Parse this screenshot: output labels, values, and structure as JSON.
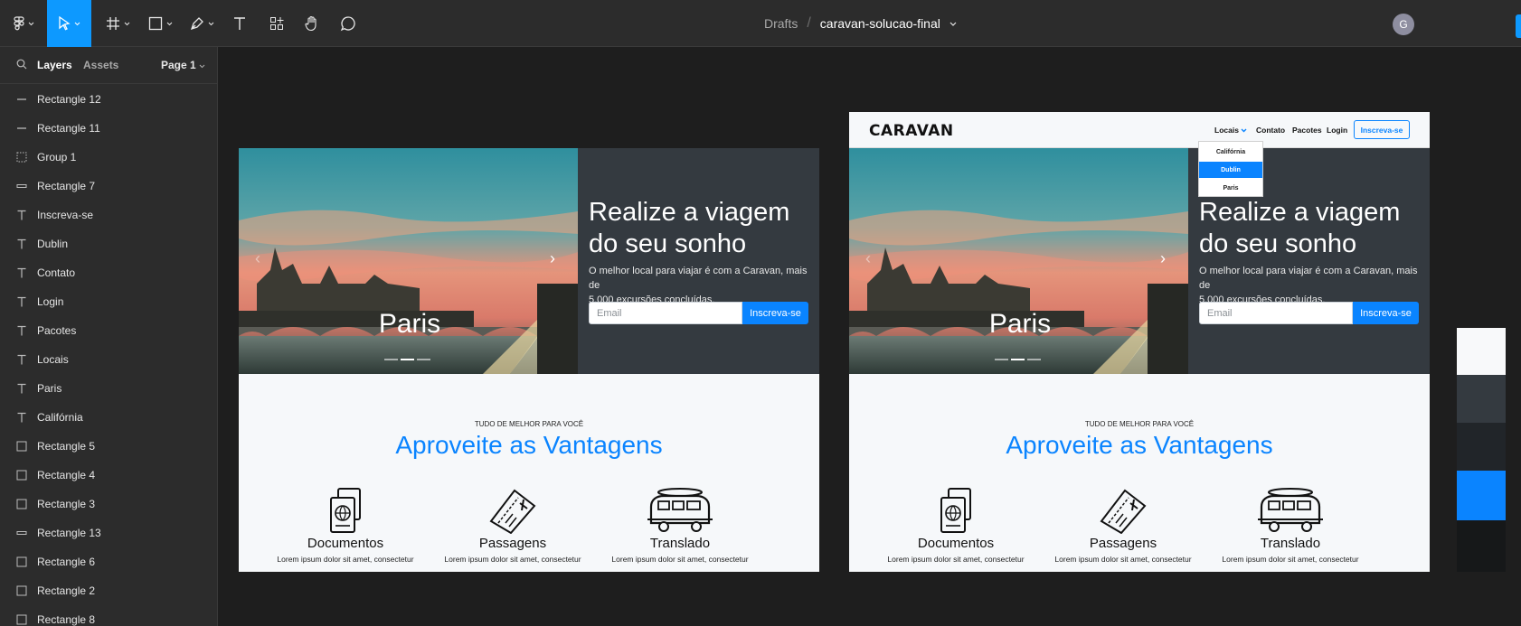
{
  "toolbar": {
    "breadcrumb_root": "Drafts",
    "breadcrumb_sep": "/",
    "file_name": "caravan-solucao-final",
    "avatar_initial": "G",
    "accent": "#0d99ff"
  },
  "sidebar": {
    "tabs": [
      "Layers",
      "Assets"
    ],
    "page_label": "Page 1",
    "layers": [
      {
        "name": "Rectangle 12",
        "icon": "line-icon"
      },
      {
        "name": "Rectangle 11",
        "icon": "line-icon"
      },
      {
        "name": "Group 1",
        "icon": "group-icon"
      },
      {
        "name": "Rectangle 7",
        "icon": "thin-rect-icon"
      },
      {
        "name": "Inscreva-se",
        "icon": "text-icon"
      },
      {
        "name": "Dublin",
        "icon": "text-icon"
      },
      {
        "name": "Contato",
        "icon": "text-icon"
      },
      {
        "name": "Login",
        "icon": "text-icon"
      },
      {
        "name": "Pacotes",
        "icon": "text-icon"
      },
      {
        "name": "Locais",
        "icon": "text-icon"
      },
      {
        "name": "Paris",
        "icon": "text-icon"
      },
      {
        "name": "Califórnia",
        "icon": "text-icon"
      },
      {
        "name": "Rectangle 5",
        "icon": "rect-icon"
      },
      {
        "name": "Rectangle 4",
        "icon": "rect-icon"
      },
      {
        "name": "Rectangle 3",
        "icon": "rect-icon"
      },
      {
        "name": "Rectangle 13",
        "icon": "thin-rect-icon"
      },
      {
        "name": "Rectangle 6",
        "icon": "rect-icon"
      },
      {
        "name": "Rectangle 2",
        "icon": "rect-icon"
      },
      {
        "name": "Rectangle 8",
        "icon": "rect-icon"
      }
    ]
  },
  "design": {
    "hero_title_line1": "Realize a viagem",
    "hero_title_line2": "do seu sonho",
    "hero_subtitle_line1": "O melhor local para viajar é com a Caravan, mais de",
    "hero_subtitle_line2": "5.000 excursões concluídas.",
    "email_placeholder": "Email",
    "subscribe_label": "Inscreva-se",
    "carousel_caption": "Paris",
    "section_kicker": "TUDO DE MELHOR PARA VOCÊ",
    "section_title": "Aproveite as Vantagens",
    "features": [
      {
        "title": "Documentos",
        "desc": "Lorem ipsum dolor sit amet, consectetur"
      },
      {
        "title": "Passagens",
        "desc": "Lorem ipsum dolor sit amet, consectetur"
      },
      {
        "title": "Translado",
        "desc": "Lorem ipsum dolor sit amet, consectetur"
      }
    ],
    "nav": {
      "logo": "CARAVAN",
      "locais": "Locais",
      "contato": "Contato",
      "pacotes": "Pacotes",
      "login": "Login",
      "cta": "Inscreva-se"
    },
    "dropdown": [
      "Califórnia",
      "Dublin",
      "Paris"
    ],
    "brand_blue": "#0a84ff",
    "hero_dark": "#343a40"
  },
  "swatches": [
    "#f8f9fa",
    "#343a40",
    "#212529",
    "#0a84ff",
    "#161819"
  ]
}
